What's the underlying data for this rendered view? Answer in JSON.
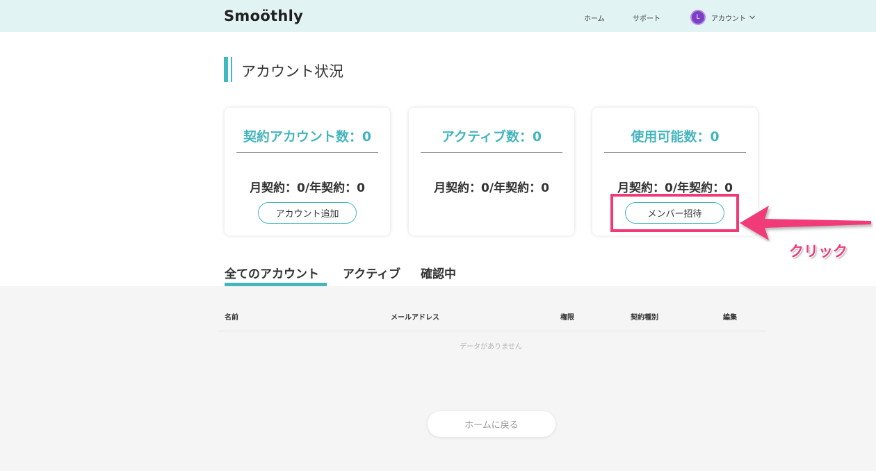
{
  "header": {
    "logo": "Smoöthly",
    "nav_home": "ホーム",
    "nav_support": "サポート",
    "avatar_initial": "L",
    "account_label": "アカウント"
  },
  "page": {
    "title": "アカウント状況"
  },
  "cards": [
    {
      "title": "契約アカウント数：0",
      "subtitle": "月契約：0/年契約：0",
      "button": "アカウント追加"
    },
    {
      "title": "アクティブ数：0",
      "subtitle": "月契約：0/年契約：0"
    },
    {
      "title": "使用可能数：0",
      "subtitle": "月契約：0/年契約：0",
      "button": "メンバー招待"
    }
  ],
  "annotation": {
    "label": "クリック",
    "color": "#f03a78"
  },
  "tabs": [
    {
      "label": "全てのアカウント",
      "selected": true
    },
    {
      "label": "アクティブ",
      "selected": false
    },
    {
      "label": "確認中",
      "selected": false
    }
  ],
  "table": {
    "columns": [
      "名前",
      "メールアドレス",
      "権限",
      "契約種別",
      "編集"
    ],
    "empty_message": "データがありません"
  },
  "footer": {
    "home_button": "ホームに戻る"
  },
  "colors": {
    "accent": "#44b5bd",
    "header_bg": "#e2f3f3",
    "avatar": "#7b3fc4"
  }
}
